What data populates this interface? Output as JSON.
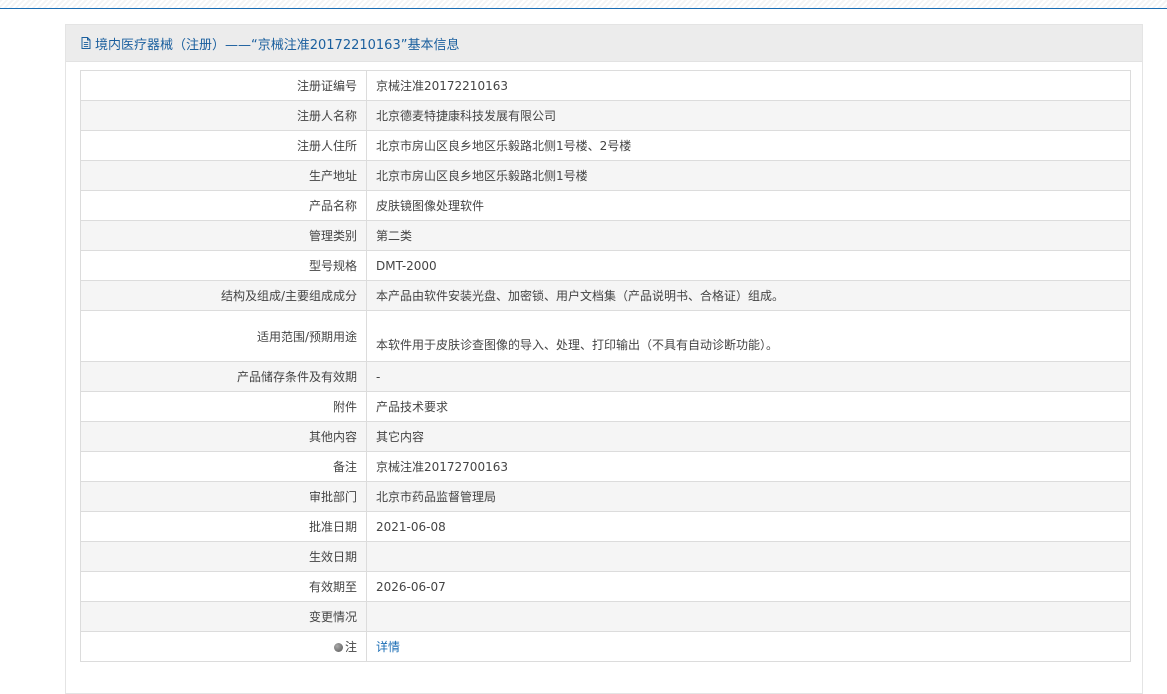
{
  "header": {
    "title": "境内医疗器械（注册）——“京械注准20172210163”基本信息"
  },
  "rows": [
    {
      "label": "注册证编号",
      "value": "京械注准20172210163"
    },
    {
      "label": "注册人名称",
      "value": "北京德麦特捷康科技发展有限公司"
    },
    {
      "label": "注册人住所",
      "value": "北京市房山区良乡地区乐毅路北侧1号楼、2号楼"
    },
    {
      "label": "生产地址",
      "value": "北京市房山区良乡地区乐毅路北侧1号楼"
    },
    {
      "label": "产品名称",
      "value": "皮肤镜图像处理软件"
    },
    {
      "label": "管理类别",
      "value": "第二类"
    },
    {
      "label": "型号规格",
      "value": "DMT-2000"
    },
    {
      "label": "结构及组成/主要组成成分",
      "value": "本产品由软件安装光盘、加密锁、用户文档集（产品说明书、合格证）组成。"
    },
    {
      "label": "适用范围/预期用途",
      "value": "本软件用于皮肤诊查图像的导入、处理、打印输出（不具有自动诊断功能）。"
    },
    {
      "label": "产品储存条件及有效期",
      "value": "-"
    },
    {
      "label": "附件",
      "value": "产品技术要求"
    },
    {
      "label": "其他内容",
      "value": "其它内容"
    },
    {
      "label": "备注",
      "value": "京械注准20172700163"
    },
    {
      "label": "审批部门",
      "value": "北京市药品监督管理局"
    },
    {
      "label": "批准日期",
      "value": "2021-06-08"
    },
    {
      "label": "生效日期",
      "value": ""
    },
    {
      "label": "有效期至",
      "value": "2026-06-07"
    },
    {
      "label": "变更情况",
      "value": ""
    }
  ],
  "note_row": {
    "label": "注",
    "link_text": "详情"
  },
  "colors": {
    "accent": "#1a6db5",
    "header_text": "#1a5f9e"
  },
  "icons": {
    "header_icon": "document-icon",
    "note_icon": "pin-icon"
  }
}
